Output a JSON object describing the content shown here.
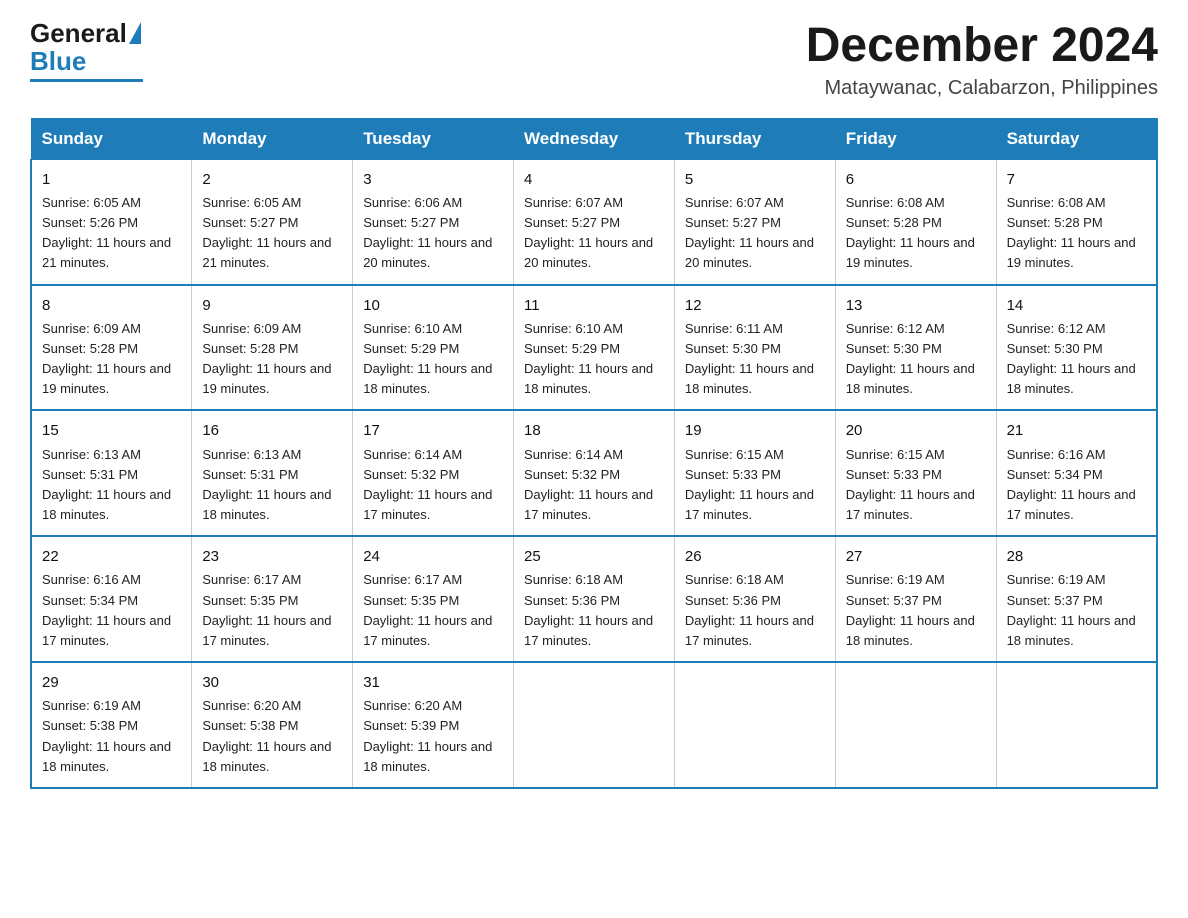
{
  "header": {
    "logo_general": "General",
    "logo_blue": "Blue",
    "month_title": "December 2024",
    "location": "Mataywanac, Calabarzon, Philippines"
  },
  "days_of_week": [
    "Sunday",
    "Monday",
    "Tuesday",
    "Wednesday",
    "Thursday",
    "Friday",
    "Saturday"
  ],
  "weeks": [
    [
      {
        "day": "1",
        "sunrise": "6:05 AM",
        "sunset": "5:26 PM",
        "daylight": "11 hours and 21 minutes."
      },
      {
        "day": "2",
        "sunrise": "6:05 AM",
        "sunset": "5:27 PM",
        "daylight": "11 hours and 21 minutes."
      },
      {
        "day": "3",
        "sunrise": "6:06 AM",
        "sunset": "5:27 PM",
        "daylight": "11 hours and 20 minutes."
      },
      {
        "day": "4",
        "sunrise": "6:07 AM",
        "sunset": "5:27 PM",
        "daylight": "11 hours and 20 minutes."
      },
      {
        "day": "5",
        "sunrise": "6:07 AM",
        "sunset": "5:27 PM",
        "daylight": "11 hours and 20 minutes."
      },
      {
        "day": "6",
        "sunrise": "6:08 AM",
        "sunset": "5:28 PM",
        "daylight": "11 hours and 19 minutes."
      },
      {
        "day": "7",
        "sunrise": "6:08 AM",
        "sunset": "5:28 PM",
        "daylight": "11 hours and 19 minutes."
      }
    ],
    [
      {
        "day": "8",
        "sunrise": "6:09 AM",
        "sunset": "5:28 PM",
        "daylight": "11 hours and 19 minutes."
      },
      {
        "day": "9",
        "sunrise": "6:09 AM",
        "sunset": "5:28 PM",
        "daylight": "11 hours and 19 minutes."
      },
      {
        "day": "10",
        "sunrise": "6:10 AM",
        "sunset": "5:29 PM",
        "daylight": "11 hours and 18 minutes."
      },
      {
        "day": "11",
        "sunrise": "6:10 AM",
        "sunset": "5:29 PM",
        "daylight": "11 hours and 18 minutes."
      },
      {
        "day": "12",
        "sunrise": "6:11 AM",
        "sunset": "5:30 PM",
        "daylight": "11 hours and 18 minutes."
      },
      {
        "day": "13",
        "sunrise": "6:12 AM",
        "sunset": "5:30 PM",
        "daylight": "11 hours and 18 minutes."
      },
      {
        "day": "14",
        "sunrise": "6:12 AM",
        "sunset": "5:30 PM",
        "daylight": "11 hours and 18 minutes."
      }
    ],
    [
      {
        "day": "15",
        "sunrise": "6:13 AM",
        "sunset": "5:31 PM",
        "daylight": "11 hours and 18 minutes."
      },
      {
        "day": "16",
        "sunrise": "6:13 AM",
        "sunset": "5:31 PM",
        "daylight": "11 hours and 18 minutes."
      },
      {
        "day": "17",
        "sunrise": "6:14 AM",
        "sunset": "5:32 PM",
        "daylight": "11 hours and 17 minutes."
      },
      {
        "day": "18",
        "sunrise": "6:14 AM",
        "sunset": "5:32 PM",
        "daylight": "11 hours and 17 minutes."
      },
      {
        "day": "19",
        "sunrise": "6:15 AM",
        "sunset": "5:33 PM",
        "daylight": "11 hours and 17 minutes."
      },
      {
        "day": "20",
        "sunrise": "6:15 AM",
        "sunset": "5:33 PM",
        "daylight": "11 hours and 17 minutes."
      },
      {
        "day": "21",
        "sunrise": "6:16 AM",
        "sunset": "5:34 PM",
        "daylight": "11 hours and 17 minutes."
      }
    ],
    [
      {
        "day": "22",
        "sunrise": "6:16 AM",
        "sunset": "5:34 PM",
        "daylight": "11 hours and 17 minutes."
      },
      {
        "day": "23",
        "sunrise": "6:17 AM",
        "sunset": "5:35 PM",
        "daylight": "11 hours and 17 minutes."
      },
      {
        "day": "24",
        "sunrise": "6:17 AM",
        "sunset": "5:35 PM",
        "daylight": "11 hours and 17 minutes."
      },
      {
        "day": "25",
        "sunrise": "6:18 AM",
        "sunset": "5:36 PM",
        "daylight": "11 hours and 17 minutes."
      },
      {
        "day": "26",
        "sunrise": "6:18 AM",
        "sunset": "5:36 PM",
        "daylight": "11 hours and 17 minutes."
      },
      {
        "day": "27",
        "sunrise": "6:19 AM",
        "sunset": "5:37 PM",
        "daylight": "11 hours and 18 minutes."
      },
      {
        "day": "28",
        "sunrise": "6:19 AM",
        "sunset": "5:37 PM",
        "daylight": "11 hours and 18 minutes."
      }
    ],
    [
      {
        "day": "29",
        "sunrise": "6:19 AM",
        "sunset": "5:38 PM",
        "daylight": "11 hours and 18 minutes."
      },
      {
        "day": "30",
        "sunrise": "6:20 AM",
        "sunset": "5:38 PM",
        "daylight": "11 hours and 18 minutes."
      },
      {
        "day": "31",
        "sunrise": "6:20 AM",
        "sunset": "5:39 PM",
        "daylight": "11 hours and 18 minutes."
      },
      null,
      null,
      null,
      null
    ]
  ],
  "labels": {
    "sunrise": "Sunrise: ",
    "sunset": "Sunset: ",
    "daylight": "Daylight: "
  }
}
